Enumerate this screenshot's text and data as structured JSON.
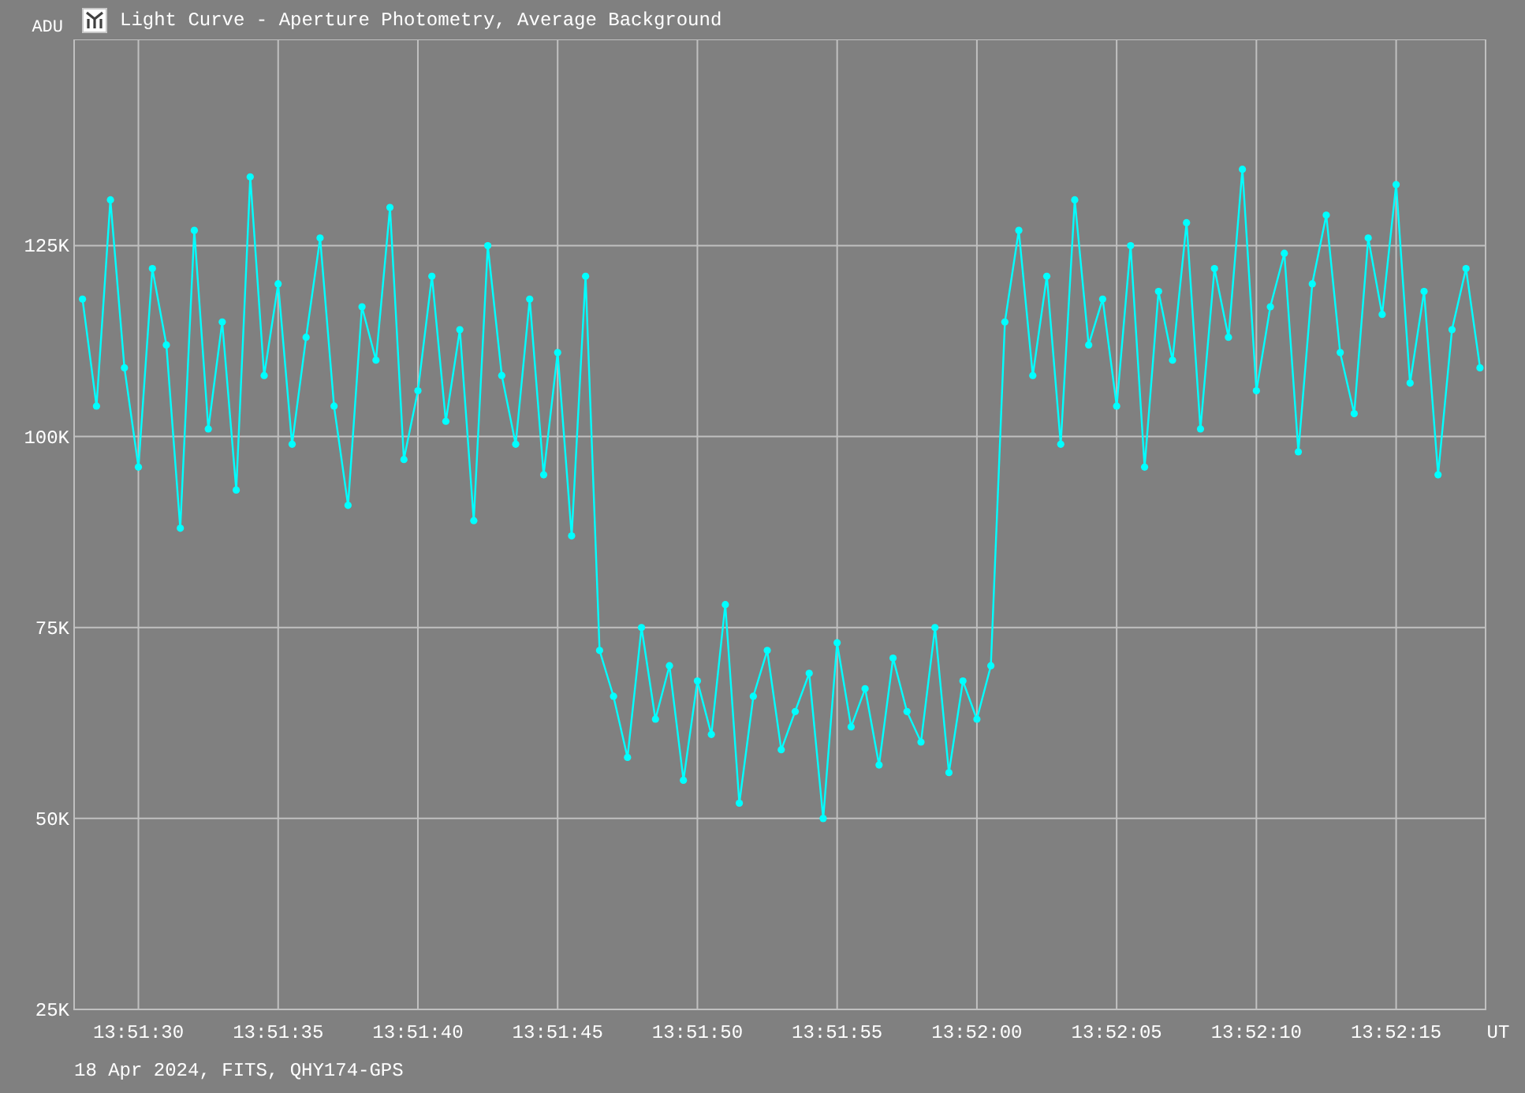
{
  "window": {
    "title": "Light Curve - Aperture Photometry, Average Background"
  },
  "chart": {
    "chart_data": {
      "type": "line",
      "grid": true,
      "ylabel": "ADU",
      "xlabel": "UT",
      "xlim": [
        49887.7,
        49938.2
      ],
      "ylim": [
        25000,
        152000
      ],
      "xticks": [
        {
          "value": 49890,
          "label": "13:51:30"
        },
        {
          "value": 49895,
          "label": "13:51:35"
        },
        {
          "value": 49900,
          "label": "13:51:40"
        },
        {
          "value": 49905,
          "label": "13:51:45"
        },
        {
          "value": 49910,
          "label": "13:51:50"
        },
        {
          "value": 49915,
          "label": "13:51:55"
        },
        {
          "value": 49920,
          "label": "13:52:00"
        },
        {
          "value": 49925,
          "label": "13:52:05"
        },
        {
          "value": 49930,
          "label": "13:52:10"
        },
        {
          "value": 49935,
          "label": "13:52:15"
        }
      ],
      "yticks": [
        {
          "value": 25000,
          "label": "25K"
        },
        {
          "value": 50000,
          "label": "50K"
        },
        {
          "value": 75000,
          "label": "75K"
        },
        {
          "value": 100000,
          "label": "100K"
        },
        {
          "value": 125000,
          "label": "125K"
        }
      ],
      "x": [
        49888,
        49888.5,
        49889,
        49889.5,
        49890,
        49890.5,
        49891,
        49891.5,
        49892,
        49892.5,
        49893,
        49893.5,
        49894,
        49894.5,
        49895,
        49895.5,
        49896,
        49896.5,
        49897,
        49897.5,
        49898,
        49898.5,
        49899,
        49899.5,
        49900,
        49900.5,
        49901,
        49901.5,
        49902,
        49902.5,
        49903,
        49903.5,
        49904,
        49904.5,
        49905,
        49905.5,
        49906,
        49906.5,
        49907,
        49907.5,
        49908,
        49908.5,
        49909,
        49909.5,
        49910,
        49910.5,
        49911,
        49911.5,
        49912,
        49912.5,
        49913,
        49913.5,
        49914,
        49914.5,
        49915,
        49915.5,
        49916,
        49916.5,
        49917,
        49917.5,
        49918,
        49918.5,
        49919,
        49919.5,
        49920,
        49920.5,
        49921,
        49921.5,
        49922,
        49922.5,
        49923,
        49923.5,
        49924,
        49924.5,
        49925,
        49925.5,
        49926,
        49926.5,
        49927,
        49927.5,
        49928,
        49928.5,
        49929,
        49929.5,
        49930,
        49930.5,
        49931,
        49931.5,
        49932,
        49932.5,
        49933,
        49933.5,
        49934,
        49934.5,
        49935,
        49935.5,
        49936,
        49936.5,
        49937,
        49937.5,
        49938
      ],
      "series": [
        {
          "color": "#00ffff",
          "marker": "circle",
          "values": [
            118000,
            104000,
            131000,
            109000,
            96000,
            122000,
            112000,
            88000,
            127000,
            101000,
            115000,
            93000,
            134000,
            108000,
            120000,
            99000,
            113000,
            126000,
            104000,
            91000,
            117000,
            110000,
            130000,
            97000,
            106000,
            121000,
            102000,
            114000,
            89000,
            125000,
            108000,
            99000,
            118000,
            95000,
            111000,
            87000,
            121000,
            72000,
            66000,
            58000,
            75000,
            63000,
            70000,
            55000,
            68000,
            61000,
            78000,
            52000,
            66000,
            72000,
            59000,
            64000,
            69000,
            50000,
            73000,
            62000,
            67000,
            57000,
            71000,
            64000,
            60000,
            75000,
            56000,
            68000,
            63000,
            70000,
            115000,
            127000,
            108000,
            121000,
            99000,
            131000,
            112000,
            118000,
            104000,
            125000,
            96000,
            119000,
            110000,
            128000,
            101000,
            122000,
            113000,
            135000,
            106000,
            117000,
            124000,
            98000,
            120000,
            129000,
            111000,
            103000,
            126000,
            116000,
            133000,
            107000,
            119000,
            95000,
            114000,
            122000,
            109000
          ]
        }
      ]
    }
  },
  "footer": {
    "text": "18 Apr 2024, FITS, QHY174-GPS"
  }
}
